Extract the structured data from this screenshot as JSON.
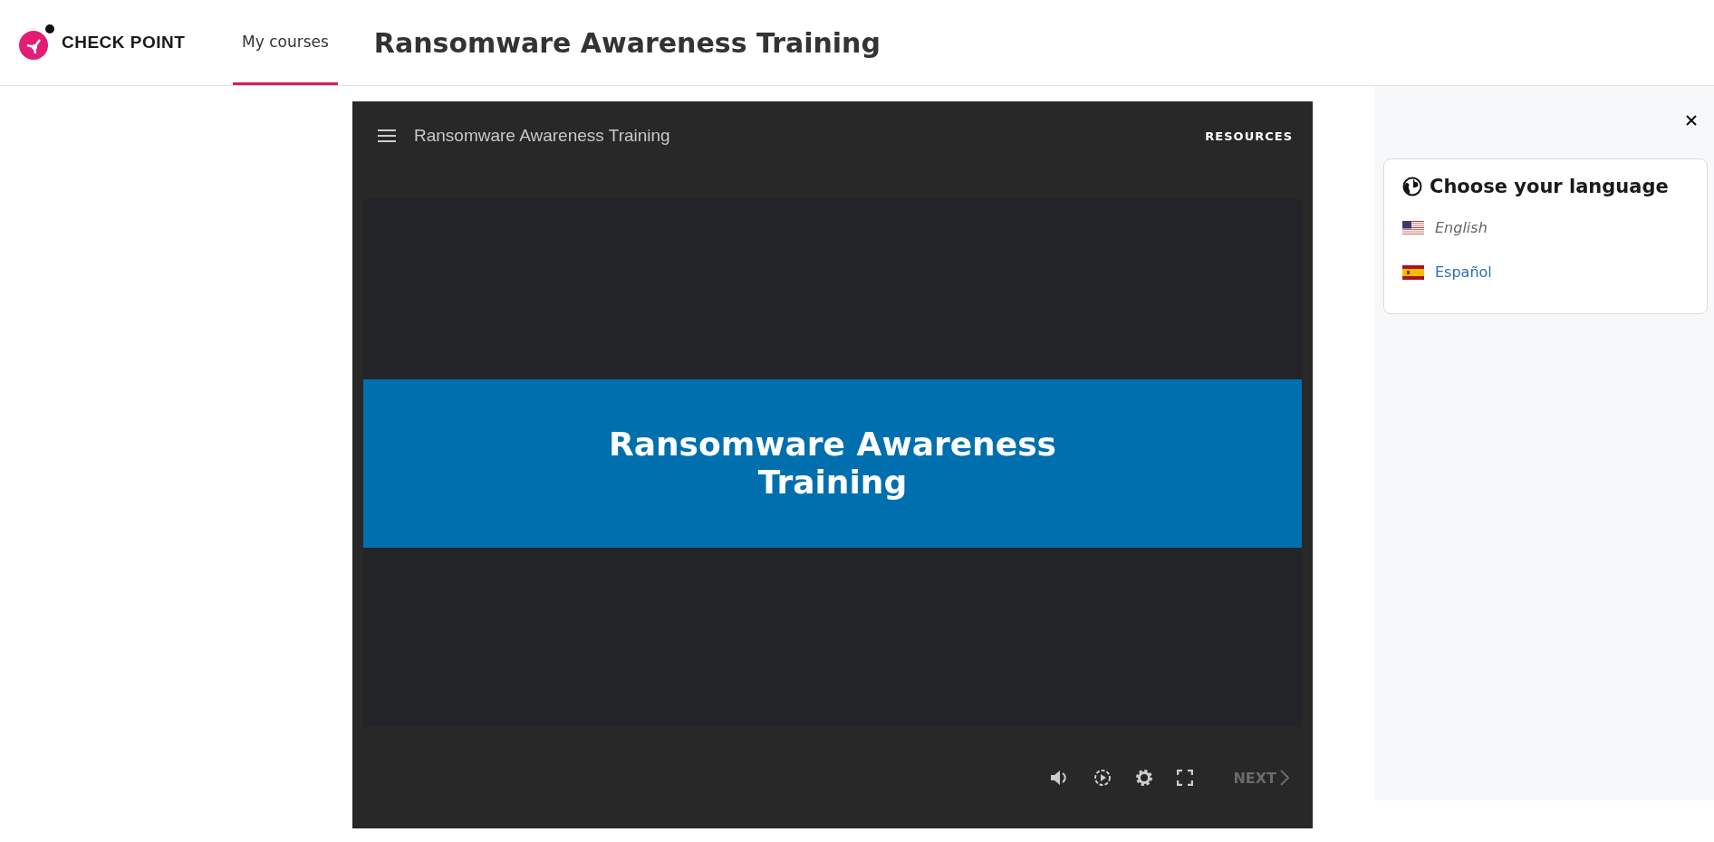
{
  "header": {
    "brand": "CHECK POINT",
    "nav": [
      {
        "label": "My courses",
        "selected": true
      }
    ],
    "title": "Ransomware Awareness Training"
  },
  "player": {
    "title": "Ransomware Awareness Training",
    "resources": "RESOURCES",
    "slide_title": "Ransomware Awareness Training",
    "next": {
      "label": "NEXT",
      "disabled": true
    }
  },
  "language_panel": {
    "heading": "Choose your language",
    "languages": [
      {
        "label": "English",
        "kind": "us",
        "selected": true
      },
      {
        "label": "Español",
        "kind": "es",
        "selected": false
      }
    ]
  }
}
